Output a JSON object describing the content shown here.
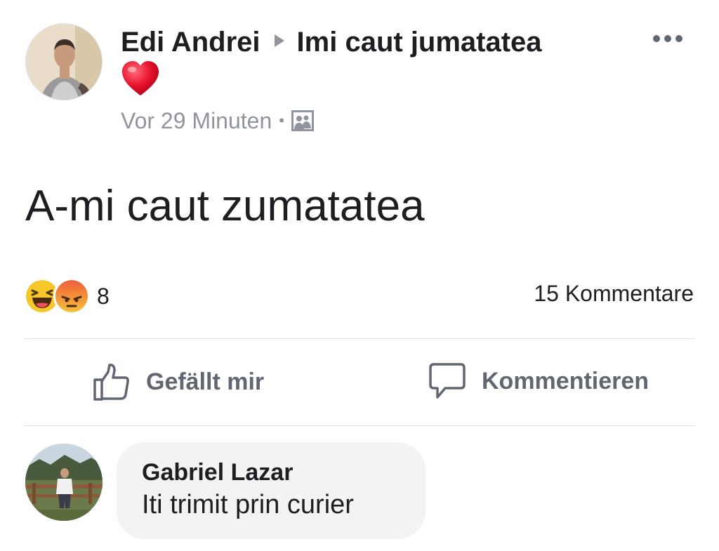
{
  "post": {
    "author": "Edi Andrei",
    "group": "Imi caut jumatatea",
    "timestamp": "Vor 29 Minuten",
    "separator": "•",
    "audience_icon": "group-photo-icon",
    "text": "A-mi caut zumatatea"
  },
  "reactions": {
    "types": [
      "haha",
      "angry"
    ],
    "count": "8",
    "comments_label": "15 Kommentare"
  },
  "actions": {
    "like_label": "Gefällt mir",
    "comment_label": "Kommentieren"
  },
  "comment": {
    "author": "Gabriel Lazar",
    "text": "Iti trimit prin curier"
  },
  "colors": {
    "text": "#1c1e21",
    "secondary": "#90949c",
    "action": "#606770",
    "bubble": "#f2f3f5",
    "heart": "#e8142d"
  }
}
